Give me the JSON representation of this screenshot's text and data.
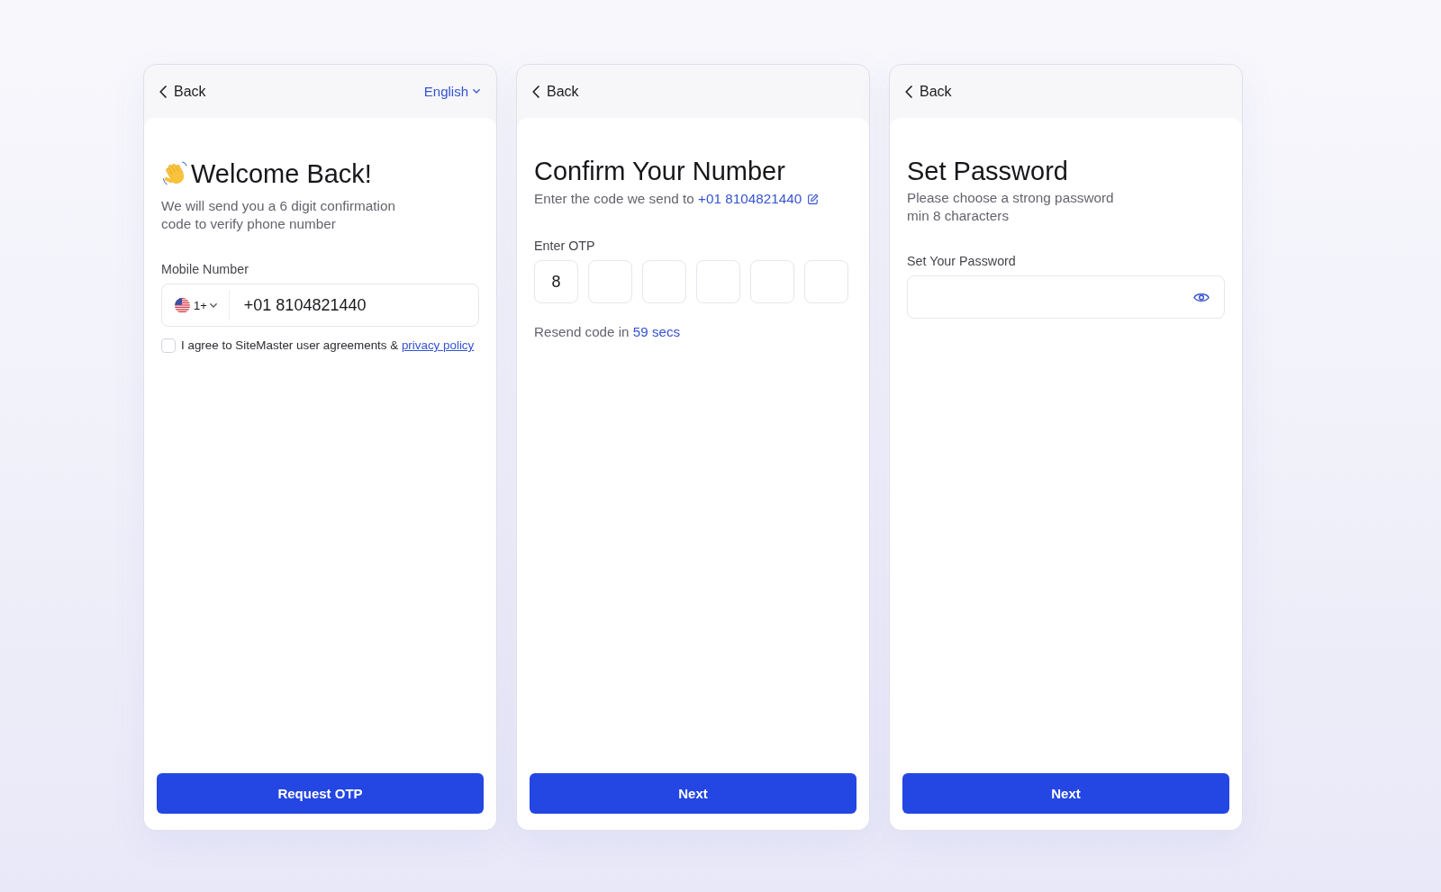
{
  "cards": [
    {
      "kind": "phone",
      "header": {
        "back_label": "Back",
        "language": "English"
      },
      "title": "Welcome Back!",
      "subtitle": "We will send you a 6 digit confirmation\ncode to verify phone number",
      "field_label": "Mobile Number",
      "phone_field": {
        "country_code": "1+",
        "value": "+01 8104821440"
      },
      "agreement": {
        "checked": false,
        "text": "I agree to SiteMaster user agreements &",
        "link": "privacy policy"
      },
      "button": "Request OTP"
    },
    {
      "kind": "otp",
      "header": {
        "back_label": "Back"
      },
      "title": "Confirm Your Number",
      "subtitle": "Enter the code we send to",
      "phone_link": "+01 8104821440",
      "field_label": "Enter OTP",
      "otp_digits": [
        "8"
      ],
      "resend": {
        "text": "Resend code in",
        "timer": "59 secs"
      },
      "button": "Next"
    },
    {
      "kind": "password",
      "header": {
        "back_label": "Back"
      },
      "title": "Set Password",
      "subtitle": "Please choose a strong password\nmin 8 characters",
      "field_label": "Set Your Password",
      "button": "Next"
    }
  ]
}
